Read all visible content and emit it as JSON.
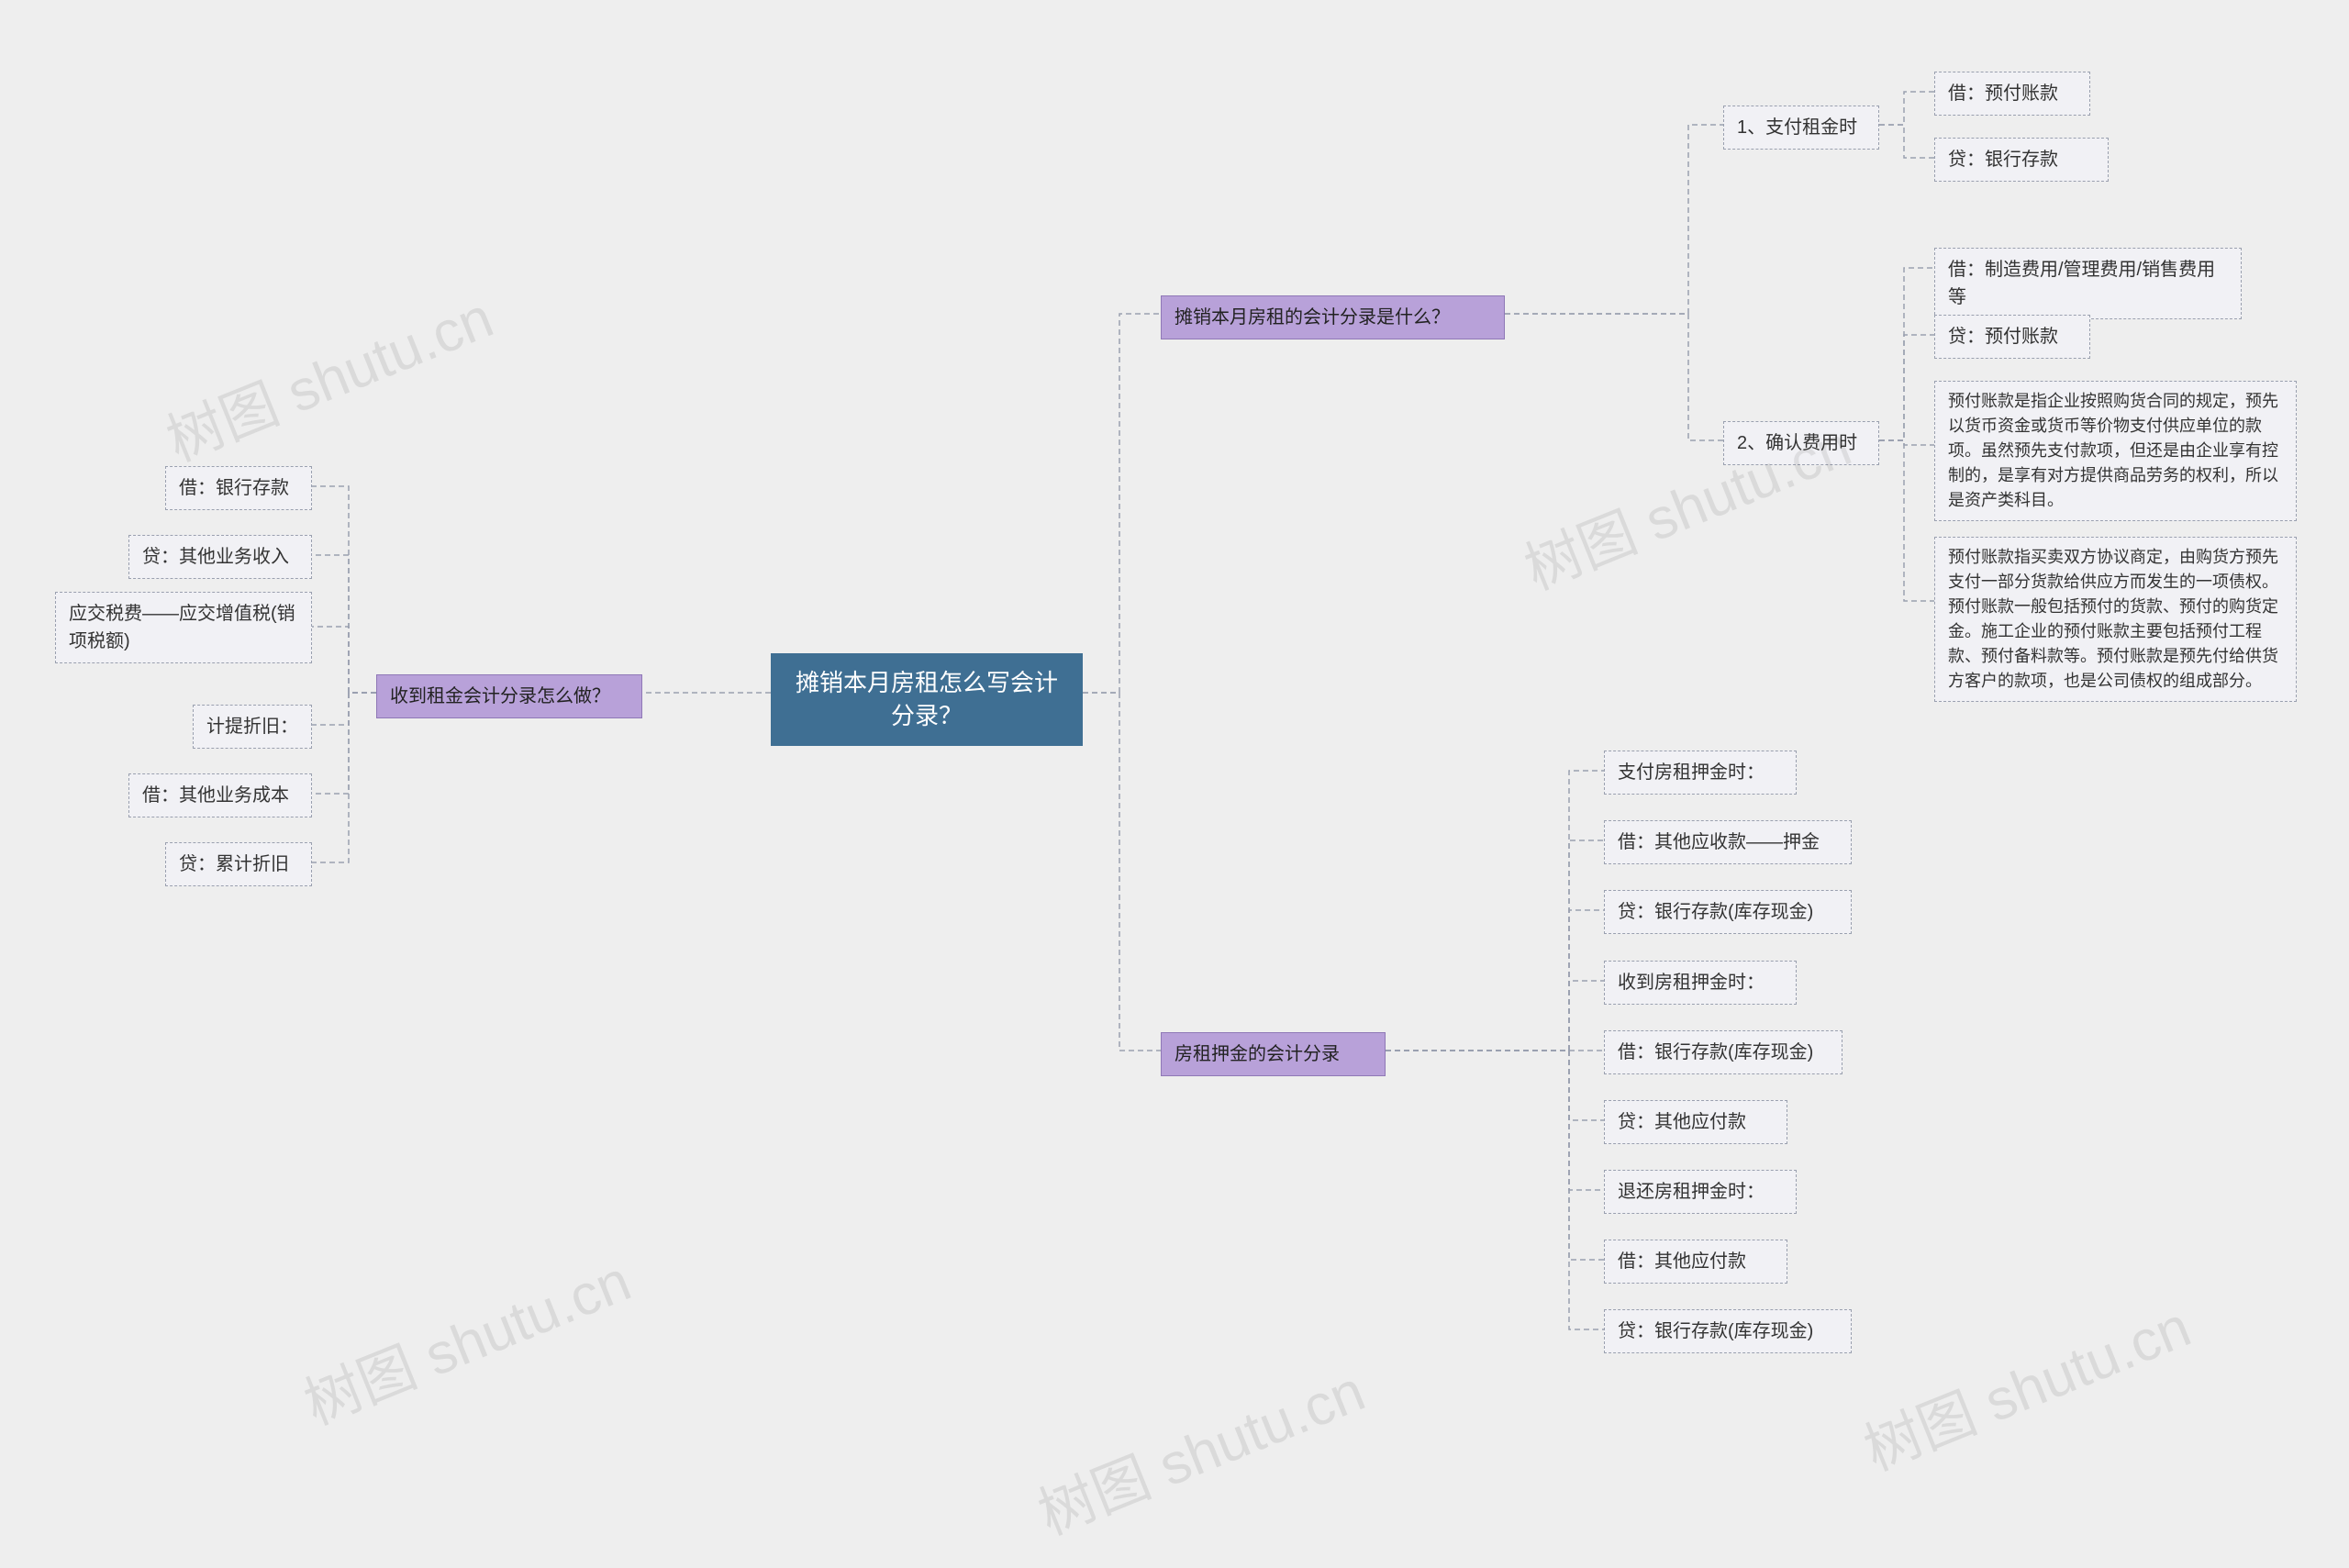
{
  "root": {
    "title": "摊销本月房租怎么写会计分录？"
  },
  "left": {
    "topic": "收到租金会计分录怎么做？",
    "items": [
      "借：银行存款",
      "贷：其他业务收入",
      "应交税费——应交增值税(销项税额)",
      "计提折旧：",
      "借：其他业务成本",
      "贷：累计折旧"
    ]
  },
  "right": {
    "amort": {
      "topic": "摊销本月房租的会计分录是什么？",
      "pay": {
        "label": "1、支付租金时",
        "items": [
          "借：预付账款",
          "贷：银行存款"
        ]
      },
      "confirm": {
        "label": "2、确认费用时",
        "items": [
          "借：制造费用/管理费用/销售费用等",
          "贷：预付账款",
          "预付账款是指企业按照购货合同的规定，预先以货币资金或货币等价物支付供应单位的款项。虽然预先支付款项，但还是由企业享有控制的，是享有对方提供商品劳务的权利，所以是资产类科目。",
          "预付账款指买卖双方协议商定，由购货方预先支付一部分货款给供应方而发生的一项债权。预付账款一般包括预付的货款、预付的购货定金。施工企业的预付账款主要包括预付工程款、预付备料款等。预付账款是预先付给供货方客户的款项，也是公司债权的组成部分。"
        ]
      }
    },
    "deposit": {
      "topic": "房租押金的会计分录",
      "items": [
        "支付房租押金时：",
        "借：其他应收款——押金",
        "贷：银行存款(库存现金)",
        "收到房租押金时：",
        "借：银行存款(库存现金)",
        "贷：其他应付款",
        "退还房租押金时：",
        "借：其他应付款",
        "贷：银行存款(库存现金)"
      ]
    }
  },
  "watermark": "树图 shutu.cn"
}
